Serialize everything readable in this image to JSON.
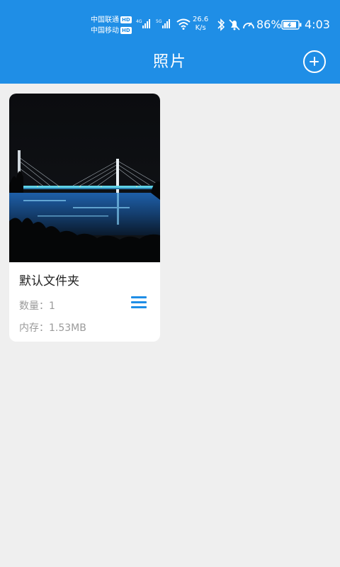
{
  "status_bar": {
    "carrier1": "中国联通",
    "carrier2": "中国移动",
    "hd_badge": "HD",
    "net1": "4G",
    "net2": "5G",
    "speed_value": "26.6",
    "speed_unit": "K/s",
    "battery": "86%",
    "time": "4:03"
  },
  "header": {
    "title": "照片",
    "add_icon": "plus-circle-icon"
  },
  "album": {
    "name": "默认文件夹",
    "count_label": "数量：",
    "count_value": "1",
    "size_label": "内存：",
    "size_value": "1.53MB",
    "menu_icon": "menu-icon"
  },
  "colors": {
    "primary": "#1f8ee6",
    "background": "#efefef"
  }
}
